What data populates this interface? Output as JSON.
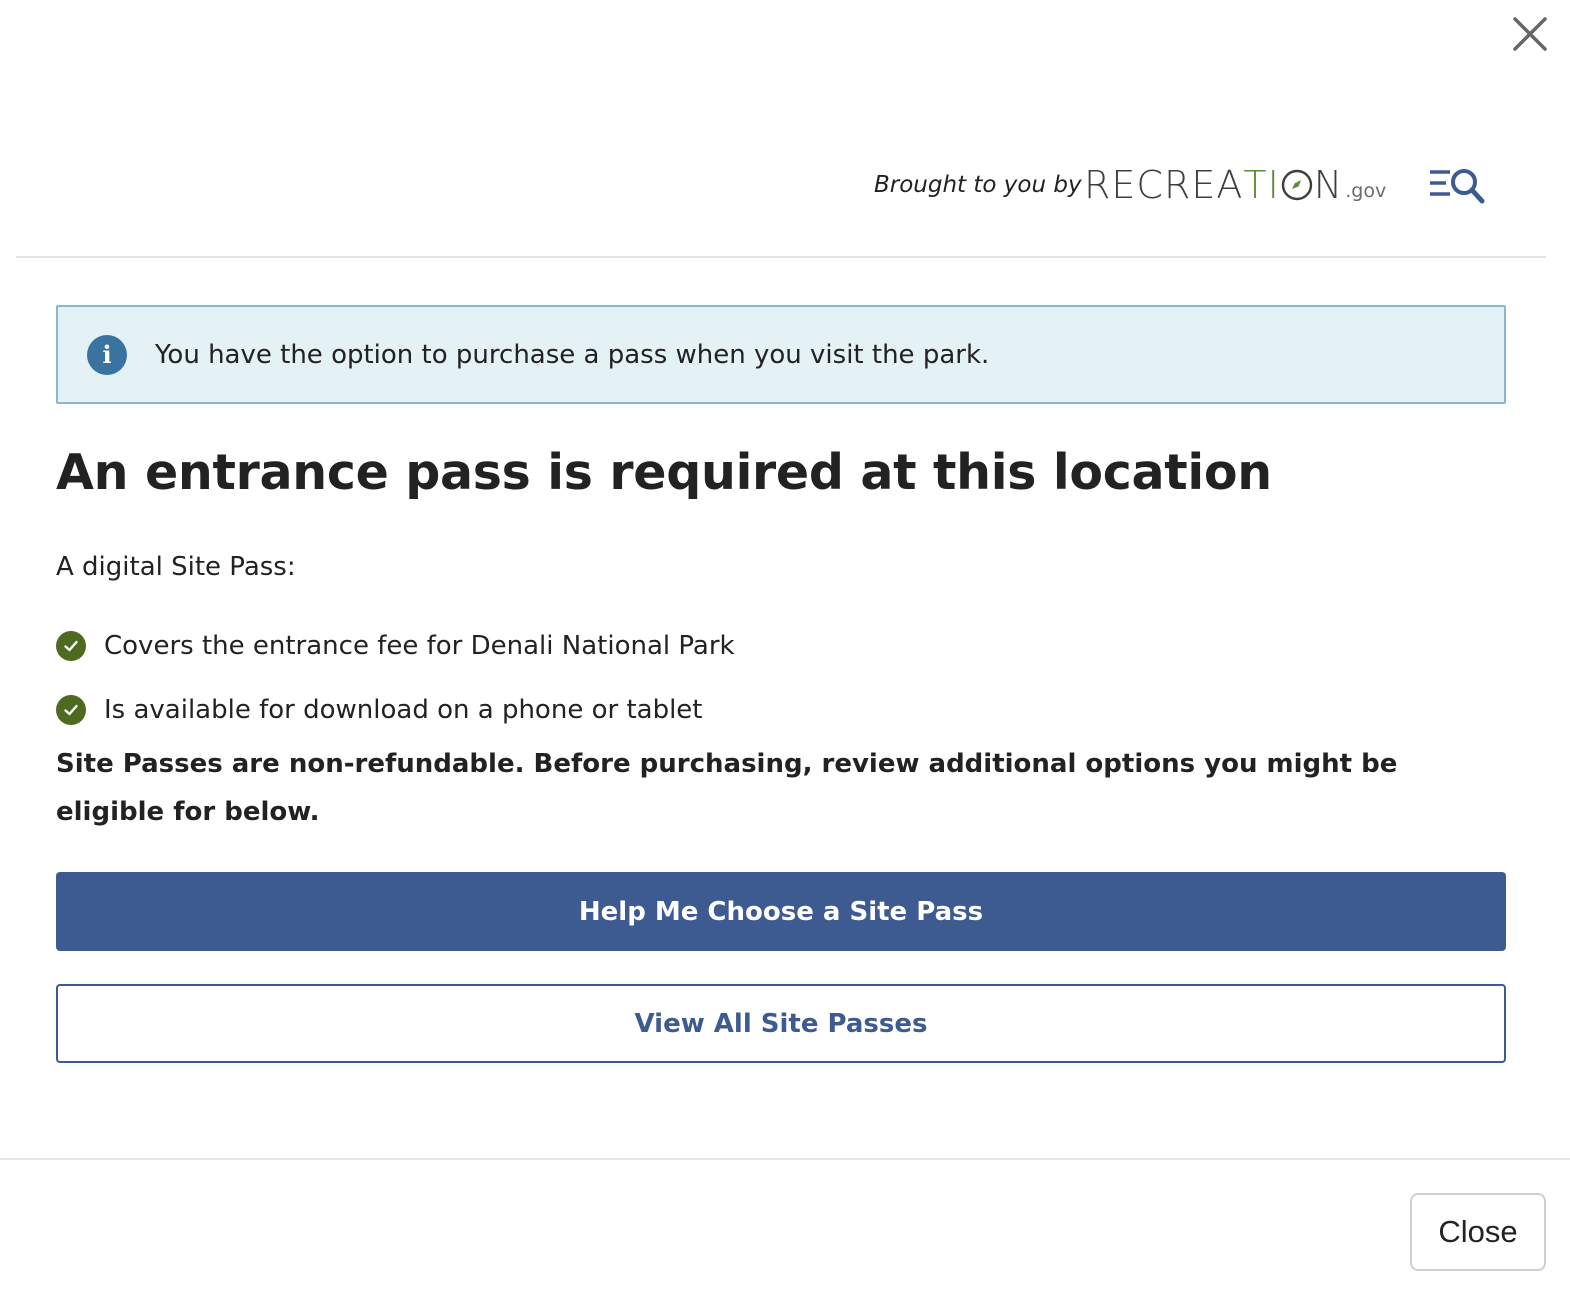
{
  "brand": {
    "tagline": "Brought to you by",
    "logo_text_start": "RECREA",
    "logo_text_mid": "TI",
    "logo_text_end": "N",
    "logo_suffix": ".gov",
    "logo_color": "#3e3e3e",
    "logo_accent_color": "#5f8a3a"
  },
  "info": {
    "icon": "info-icon",
    "icon_glyph": "i",
    "message": "You have the option to purchase a pass when you visit the park."
  },
  "content": {
    "heading": "An entrance pass is required at this location",
    "intro": "A digital Site Pass:",
    "features": [
      "Covers the entrance fee for Denali National Park",
      "Is available for download on a phone or tablet"
    ],
    "note": "Site Passes are non-refundable. Before purchasing, review additional options you might be eligible for below."
  },
  "actions": {
    "primary_label": "Help Me Choose a Site Pass",
    "secondary_label": "View All Site Passes",
    "close_label": "Close"
  },
  "colors": {
    "primary": "#3d5a91",
    "info_bg": "#e4f1f5",
    "check": "#4d6b1f"
  },
  "icons": {
    "close": "close-icon",
    "menu_search": "menu-search-icon",
    "check": "check-circle-icon"
  }
}
